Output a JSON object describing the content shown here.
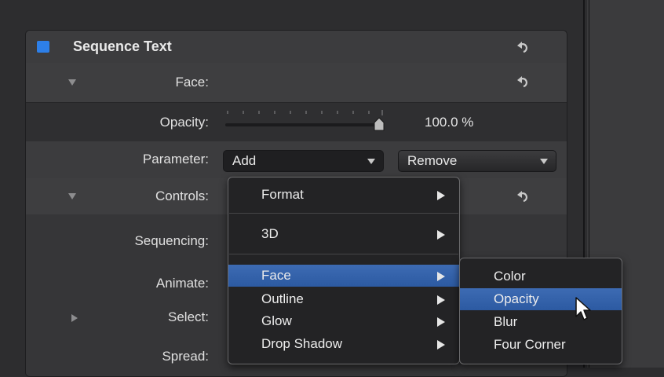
{
  "inspector": {
    "title": "Sequence Text",
    "face_label": "Face:",
    "opacity_label": "Opacity:",
    "opacity_value": "100.0 %",
    "opacity_level_percent": 100,
    "parameter_label": "Parameter:",
    "add_value": "Add",
    "remove_value": "Remove",
    "controls_label": "Controls:",
    "sequencing_label": "Sequencing:",
    "animate_label": "Animate:",
    "select_label": "Select:",
    "spread_label": "Spread:",
    "enable_color": "#2d7fe8"
  },
  "menu": {
    "items": [
      {
        "label": "Format",
        "has_submenu": true
      },
      {
        "label": "3D",
        "has_submenu": true
      },
      {
        "label": "Face",
        "has_submenu": true,
        "highlighted": true
      },
      {
        "label": "Outline",
        "has_submenu": true
      },
      {
        "label": "Glow",
        "has_submenu": true
      },
      {
        "label": "Drop Shadow",
        "has_submenu": true
      }
    ],
    "submenu": [
      {
        "label": "Color"
      },
      {
        "label": "Opacity",
        "highlighted": true
      },
      {
        "label": "Blur"
      },
      {
        "label": "Four Corner"
      }
    ],
    "highlight_color": "#355fa8"
  },
  "icons": {
    "reset": "reset-arrow-icon",
    "cursor": "mouse-pointer-icon"
  }
}
